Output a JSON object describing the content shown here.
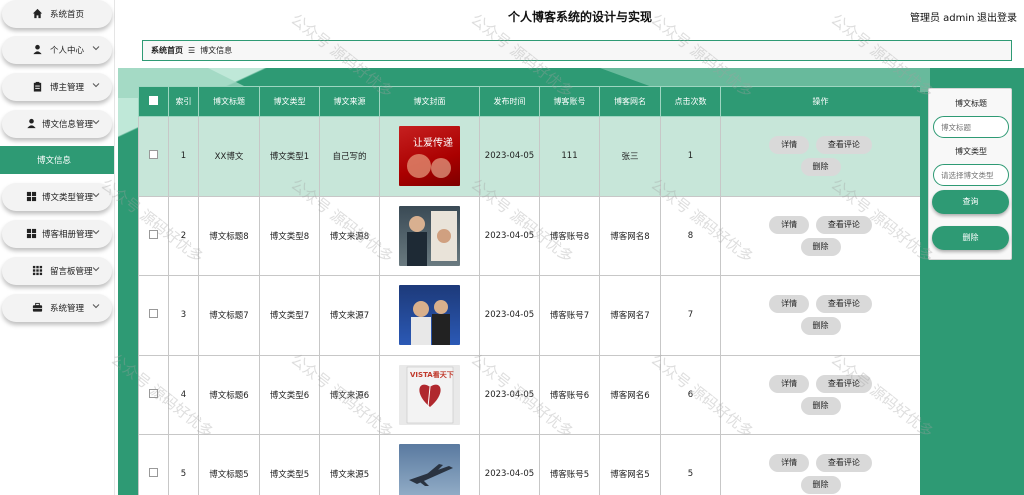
{
  "header": {
    "title": "个人博客系统的设计与实现",
    "admin_label": "管理员 admin",
    "logout_label": "退出登录"
  },
  "sidebar": {
    "items": [
      {
        "label": "系统首页",
        "icon": "home-icon"
      },
      {
        "label": "个人中心",
        "icon": "user-icon"
      },
      {
        "label": "博主管理",
        "icon": "clipboard-icon"
      },
      {
        "label": "博文信息管理",
        "icon": "user-icon"
      },
      {
        "label": "博文类型管理",
        "icon": "grid-icon"
      },
      {
        "label": "博客相册管理",
        "icon": "grid-icon"
      },
      {
        "label": "留言板管理",
        "icon": "grid-dots-icon"
      },
      {
        "label": "系统管理",
        "icon": "briefcase-icon"
      }
    ],
    "active_submenu": "博文信息"
  },
  "breadcrumb": {
    "home": "系统首页",
    "separator": "☰",
    "current": "博文信息"
  },
  "table": {
    "headers": [
      "索引",
      "博文标题",
      "博文类型",
      "博文来源",
      "博文封面",
      "发布时间",
      "博客账号",
      "博客网名",
      "点击次数",
      "操作"
    ],
    "rows": [
      {
        "index": "1",
        "title": "XX博文",
        "type": "博文类型1",
        "source": "自己写的",
        "time": "2023-04-05",
        "account": "111",
        "name": "张三",
        "clicks": "1"
      },
      {
        "index": "2",
        "title": "博文标题8",
        "type": "博文类型8",
        "source": "博文来源8",
        "time": "2023-04-05",
        "account": "博客账号8",
        "name": "博客网名8",
        "clicks": "8"
      },
      {
        "index": "3",
        "title": "博文标题7",
        "type": "博文类型7",
        "source": "博文来源7",
        "time": "2023-04-05",
        "account": "博客账号7",
        "name": "博客网名7",
        "clicks": "7"
      },
      {
        "index": "4",
        "title": "博文标题6",
        "type": "博文类型6",
        "source": "博文来源6",
        "time": "2023-04-05",
        "account": "博客账号6",
        "name": "博客网名6",
        "clicks": "6"
      },
      {
        "index": "5",
        "title": "博文标题5",
        "type": "博文类型5",
        "source": "博文来源5",
        "time": "2023-04-05",
        "account": "博客账号5",
        "name": "博客网名5",
        "clicks": "5"
      }
    ],
    "actions": {
      "detail": "详情",
      "comments": "查看评论",
      "delete": "删除"
    },
    "cover_texts": {
      "row1": "让爱传递",
      "row4": "VISTA看天下"
    }
  },
  "search_panel": {
    "title_label": "博文标题",
    "title_placeholder": "博文标题",
    "type_label": "博文类型",
    "type_placeholder": "请选择博文类型",
    "search_button": "查询",
    "delete_button": "删除"
  },
  "watermark": "公众号 源码好优多",
  "colors": {
    "primary": "#2e9a74",
    "row_highlight": "#c7e6d9",
    "light_green": "#bfe8d8"
  }
}
